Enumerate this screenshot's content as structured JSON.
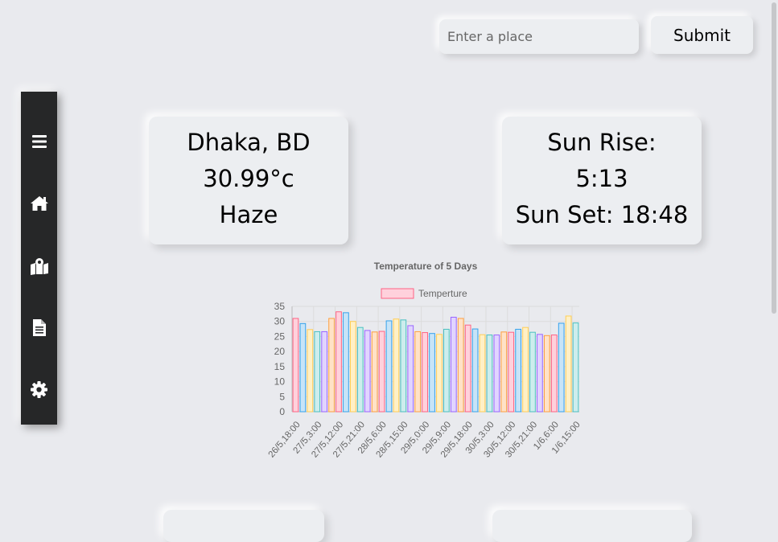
{
  "search": {
    "placeholder": "Enter a place",
    "value": ""
  },
  "submit_label": "Submit",
  "sidebar": {
    "items": [
      {
        "icon": "menu-icon"
      },
      {
        "icon": "home-icon"
      },
      {
        "icon": "map-icon"
      },
      {
        "icon": "document-icon"
      },
      {
        "icon": "gear-icon"
      }
    ]
  },
  "weather": {
    "location": "Dhaka, BD",
    "temperature": "30.99°c",
    "condition": "Haze"
  },
  "sun": {
    "rise_label": "Sun Rise:",
    "rise_time": "5:13",
    "set_text": "Sun Set: 18:48"
  },
  "chart_data": {
    "type": "bar",
    "title": "Temperature of 5 Days",
    "series": [
      {
        "name": "Temperture",
        "values": [
          31.0,
          29.3,
          27.3,
          26.6,
          26.6,
          31.0,
          33.2,
          32.9,
          30.0,
          28.0,
          27.0,
          26.5,
          26.7,
          30.2,
          30.8,
          30.5,
          28.6,
          26.6,
          26.3,
          26.0,
          25.7,
          27.4,
          31.4,
          31.0,
          28.8,
          27.5,
          25.6,
          25.5,
          25.5,
          26.5,
          26.4,
          27.4,
          28.0,
          26.4,
          25.7,
          25.3,
          25.5,
          29.4,
          31.8,
          29.5
        ]
      }
    ],
    "categories": [
      "26/5,18:00",
      "26/5,21:00",
      "27/5,0:00",
      "27/5,3:00",
      "27/5,6:00",
      "27/5,9:00",
      "27/5,12:00",
      "27/5,15:00",
      "27/5,18:00",
      "27/5,21:00",
      "28/5,0:00",
      "28/5,3:00",
      "28/5,6:00",
      "28/5,9:00",
      "28/5,12:00",
      "28/5,15:00",
      "28/5,18:00",
      "28/5,21:00",
      "29/5,0:00",
      "29/5,3:00",
      "29/5,6:00",
      "29/5,9:00",
      "29/5,12:00",
      "29/5,15:00",
      "29/5,18:00",
      "29/5,21:00",
      "30/5,0:00",
      "30/5,3:00",
      "30/5,6:00",
      "30/5,9:00",
      "30/5,12:00",
      "30/5,15:00",
      "30/5,18:00",
      "30/5,21:00",
      "1/6,0:00",
      "1/6,3:00",
      "1/6,6:00",
      "1/6,9:00",
      "1/6,12:00",
      "1/6,15:00"
    ],
    "tick_labels": [
      "26/5,18:00",
      "27/5,3:00",
      "27/5,12:00",
      "27/5,21:00",
      "28/5,6:00",
      "28/5,15:00",
      "29/5,0:00",
      "29/5,9:00",
      "29/5,18:00",
      "30/5,3:00",
      "30/5,12:00",
      "30/5,21:00",
      "1/6,6:00",
      "1/6,15:00"
    ],
    "y_ticks": [
      0,
      5,
      10,
      15,
      20,
      25,
      30,
      35
    ],
    "ylim": [
      0,
      35
    ],
    "grid": true,
    "legend_position": "top",
    "colors": [
      "#ff6384",
      "#36a2eb",
      "#ffce56",
      "#4bc0c0",
      "#9966ff",
      "#ff9f40"
    ],
    "fill_colors": [
      "#ffd1dc",
      "#c7e4f8",
      "#fff0c6",
      "#cdeded",
      "#e1d4ff",
      "#ffe2c7"
    ]
  }
}
